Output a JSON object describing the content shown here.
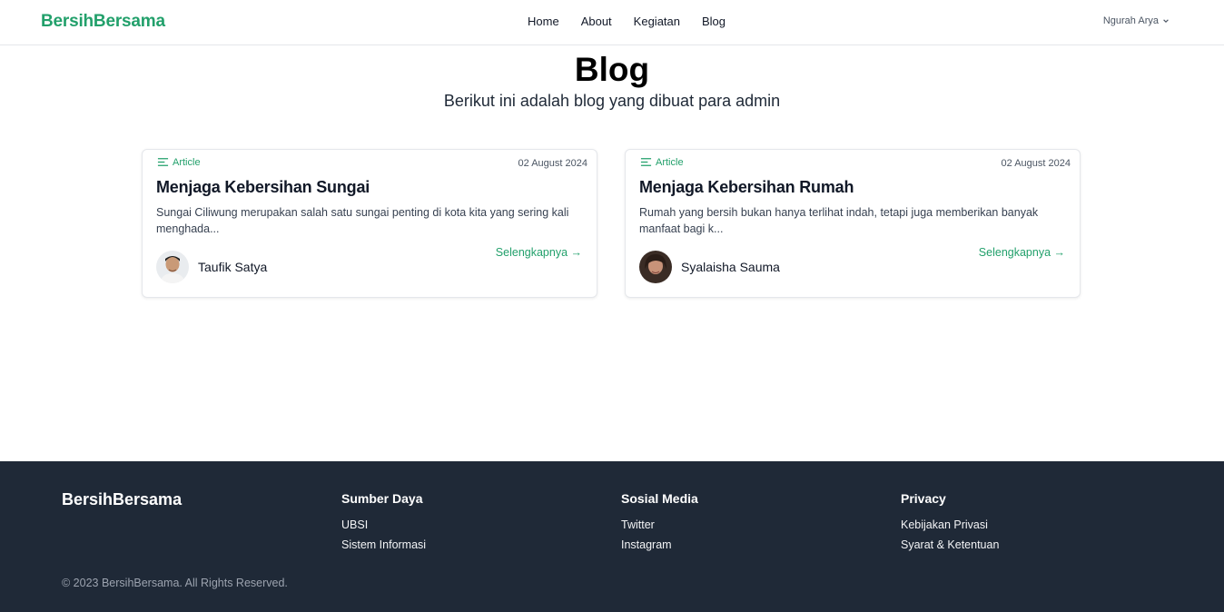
{
  "nav": {
    "brand": "BersihBersama",
    "links": [
      "Home",
      "About",
      "Kegiatan",
      "Blog"
    ],
    "user": "Ngurah Arya",
    "user_icon": "chevron-down-icon"
  },
  "hero": {
    "title": "Blog",
    "subtitle": "Berikut ini adalah blog yang dibuat para admin"
  },
  "posts": [
    {
      "tag": "Article",
      "tag_icon": "lines-icon",
      "date": "02 August 2024",
      "title": "Menjaga Kebersihan Sungai",
      "excerpt": "Sungai Ciliwung merupakan salah satu sungai penting di kota kita yang sering kali menghada...",
      "readmore": "Selengkapnya →",
      "author": "Taufik Satya"
    },
    {
      "tag": "Article",
      "tag_icon": "lines-icon",
      "date": "02 August 2024",
      "title": "Menjaga Kebersihan Rumah",
      "excerpt": "Rumah yang bersih bukan hanya terlihat indah, tetapi juga memberikan banyak manfaat bagi k...",
      "readmore": "Selengkapnya →",
      "author": "Syalaisha Sauma"
    }
  ],
  "footer": {
    "brand": "BersihBersama",
    "columns": [
      {
        "heading": "Sumber Daya",
        "links": [
          "UBSI",
          "Sistem Informasi"
        ]
      },
      {
        "heading": "Sosial Media",
        "links": [
          "Twitter",
          "Instagram"
        ]
      },
      {
        "heading": "Privacy",
        "links": [
          "Kebijakan Privasi",
          "Syarat & Ketentuan"
        ]
      }
    ],
    "copyright": "© 2023 BersihBersama. All Rights Reserved."
  },
  "colors": {
    "accent": "#22a06b",
    "footer_bg": "#1f2937"
  }
}
